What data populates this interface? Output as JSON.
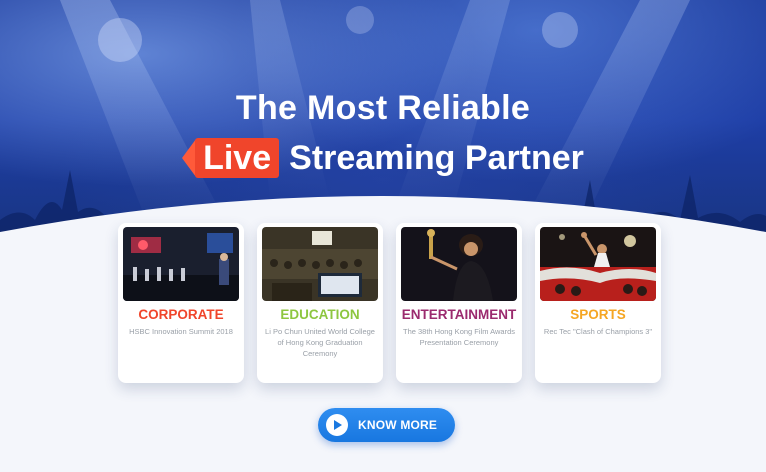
{
  "hero": {
    "title_line1": "The Most Reliable",
    "live_badge": "Live",
    "title_line2_rest": "Streaming Partner"
  },
  "cards": [
    {
      "category": "CORPORATE",
      "color": "#f0452b",
      "description": "HSBC Innovation Summit 2018",
      "photo": "conference-photo"
    },
    {
      "category": "EDUCATION",
      "color": "#8dc63f",
      "description": "Li Po Chun United World College of Hong Kong Graduation Ceremony",
      "photo": "auditorium-photo"
    },
    {
      "category": "ENTERTAINMENT",
      "color": "#9b2a6e",
      "description": "The 38th Hong Kong Film Awards Presentation Ceremony",
      "photo": "award-photo"
    },
    {
      "category": "SPORTS",
      "color": "#f5a623",
      "description": "Rec Tec \"Clash of Champions 3\"",
      "photo": "boxing-photo"
    }
  ],
  "cta": {
    "label": "KNOW MORE",
    "icon": "play-icon"
  },
  "colors": {
    "hero_blue": "#1e3ea6",
    "live_red": "#f0452b",
    "button_blue": "#1877e0"
  }
}
